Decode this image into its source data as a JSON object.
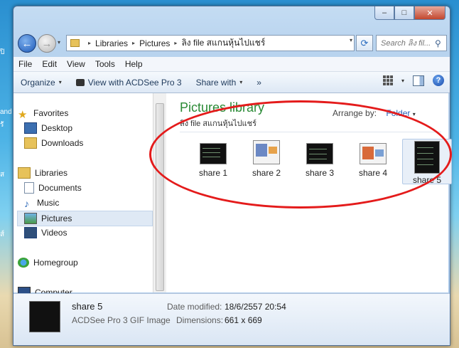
{
  "desktop": {
    "left_labels": [
      "ปิ",
      "and",
      "รั",
      "ส",
      "ส์"
    ]
  },
  "window": {
    "caption_buttons": {
      "minimize": "–",
      "maximize": "□",
      "close": "✕"
    },
    "nav": {
      "back": "←",
      "forward": "→",
      "dropdown": "▾"
    },
    "breadcrumb": [
      "Libraries",
      "Pictures",
      "ลิง file สแกนหุ้นไปแชร์"
    ],
    "breadcrumb_sep": "▸",
    "refresh": "⟳",
    "search": {
      "placeholder": "Search ลิง fil...",
      "icon": "⚲"
    },
    "menubar": [
      "File",
      "Edit",
      "View",
      "Tools",
      "Help"
    ],
    "toolbar": {
      "organize": "Organize",
      "view_with": "View with ACDSee Pro 3",
      "share_with": "Share with",
      "more": "»",
      "help": "?"
    },
    "navigation": {
      "favorites": "Favorites",
      "desktop": "Desktop",
      "downloads": "Downloads",
      "libraries": "Libraries",
      "documents": "Documents",
      "music": "Music",
      "pictures": "Pictures",
      "videos": "Videos",
      "homegroup": "Homegroup",
      "computer": "Computer"
    },
    "library": {
      "title": "Pictures library",
      "subtitle": "ลิง file สแกนหุ้นไปแชร์",
      "arrange_label": "Arrange by:",
      "arrange_value": "Folder"
    },
    "files": [
      {
        "name": "share 1"
      },
      {
        "name": "share 2"
      },
      {
        "name": "share 3"
      },
      {
        "name": "share 4"
      },
      {
        "name": "share 5"
      }
    ],
    "details": {
      "name": "share 5",
      "type": "ACDSee Pro 3 GIF Image",
      "date_label": "Date modified:",
      "date_value": "18/6/2557 20:54",
      "dim_label": "Dimensions:",
      "dim_value": "661 x 669"
    }
  },
  "colors": {
    "accent_green": "#2a8a35",
    "annotation_red": "#e41b1b",
    "link_blue": "#2860b8"
  }
}
